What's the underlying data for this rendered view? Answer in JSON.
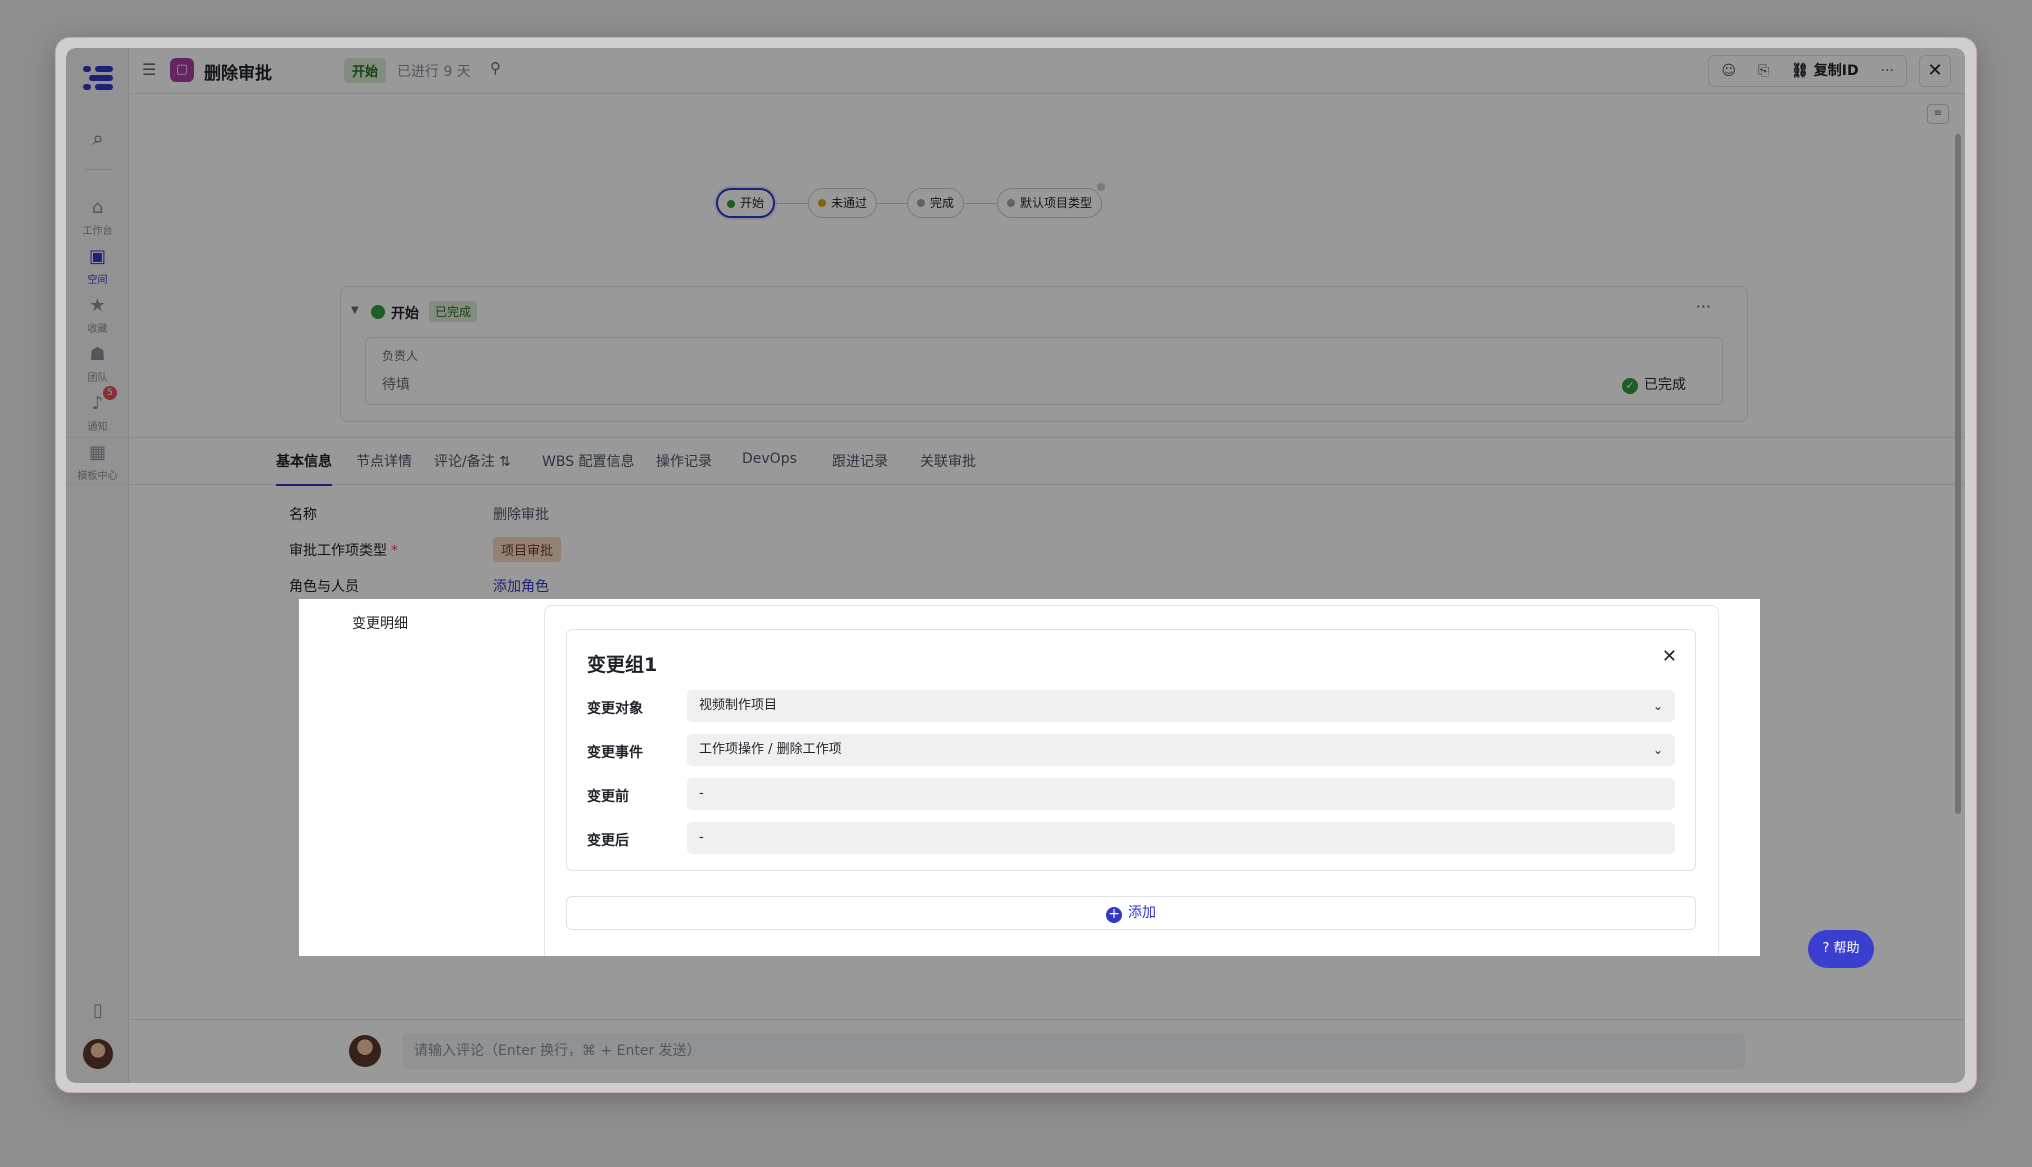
{
  "header": {
    "title": "删除审批",
    "state": "开始",
    "elapsed": "已进行 9 天",
    "copy_id": "复制ID"
  },
  "nav": {
    "items": [
      {
        "label": "工作台",
        "icon": "home-icon"
      },
      {
        "label": "空间",
        "icon": "space-icon"
      },
      {
        "label": "收藏",
        "icon": "star-icon"
      },
      {
        "label": "团队",
        "icon": "team-icon"
      },
      {
        "label": "通知",
        "icon": "bell-icon",
        "badge": "5"
      },
      {
        "label": "模板中心",
        "icon": "grid-icon"
      }
    ]
  },
  "flow": {
    "nodes": [
      {
        "label": "开始",
        "color": "#2e9b3a"
      },
      {
        "label": "未通过",
        "color": "#e0a21a"
      },
      {
        "label": "完成",
        "color": "#a0a4ab"
      },
      {
        "label": "默认项目类型",
        "color": "#a0a4ab"
      }
    ]
  },
  "node_card": {
    "name": "开始",
    "status": "已完成",
    "owner_label": "负责人",
    "owner_value": "待填",
    "done_label": "已完成"
  },
  "tabs": [
    "基本信息",
    "节点详情",
    "评论/备注",
    "WBS 配置信息",
    "操作记录",
    "DevOps",
    "跟进记录",
    "关联审批"
  ],
  "fields": {
    "name_label": "名称",
    "name_value": "删除审批",
    "type_label": "审批工作项类型",
    "type_required": "*",
    "type_value": "项目审批",
    "roles_label": "角色与人员",
    "roles_value": "添加角色",
    "changes_label": "变更明细"
  },
  "change_group": {
    "title": "变更组1",
    "rows": [
      {
        "label": "变更对象",
        "value": "视频制作项目"
      },
      {
        "label": "变更事件",
        "value": "工作项操作 / 删除工作项"
      },
      {
        "label": "变更前",
        "value": "-"
      },
      {
        "label": "变更后",
        "value": "-"
      }
    ],
    "add_label": "添加"
  },
  "comment": {
    "placeholder": "请输入评论（Enter 换行，⌘ + Enter 发送）"
  },
  "help_label": "帮助",
  "colors": {
    "accent": "#2f38c7",
    "success": "#2e9b3a"
  }
}
